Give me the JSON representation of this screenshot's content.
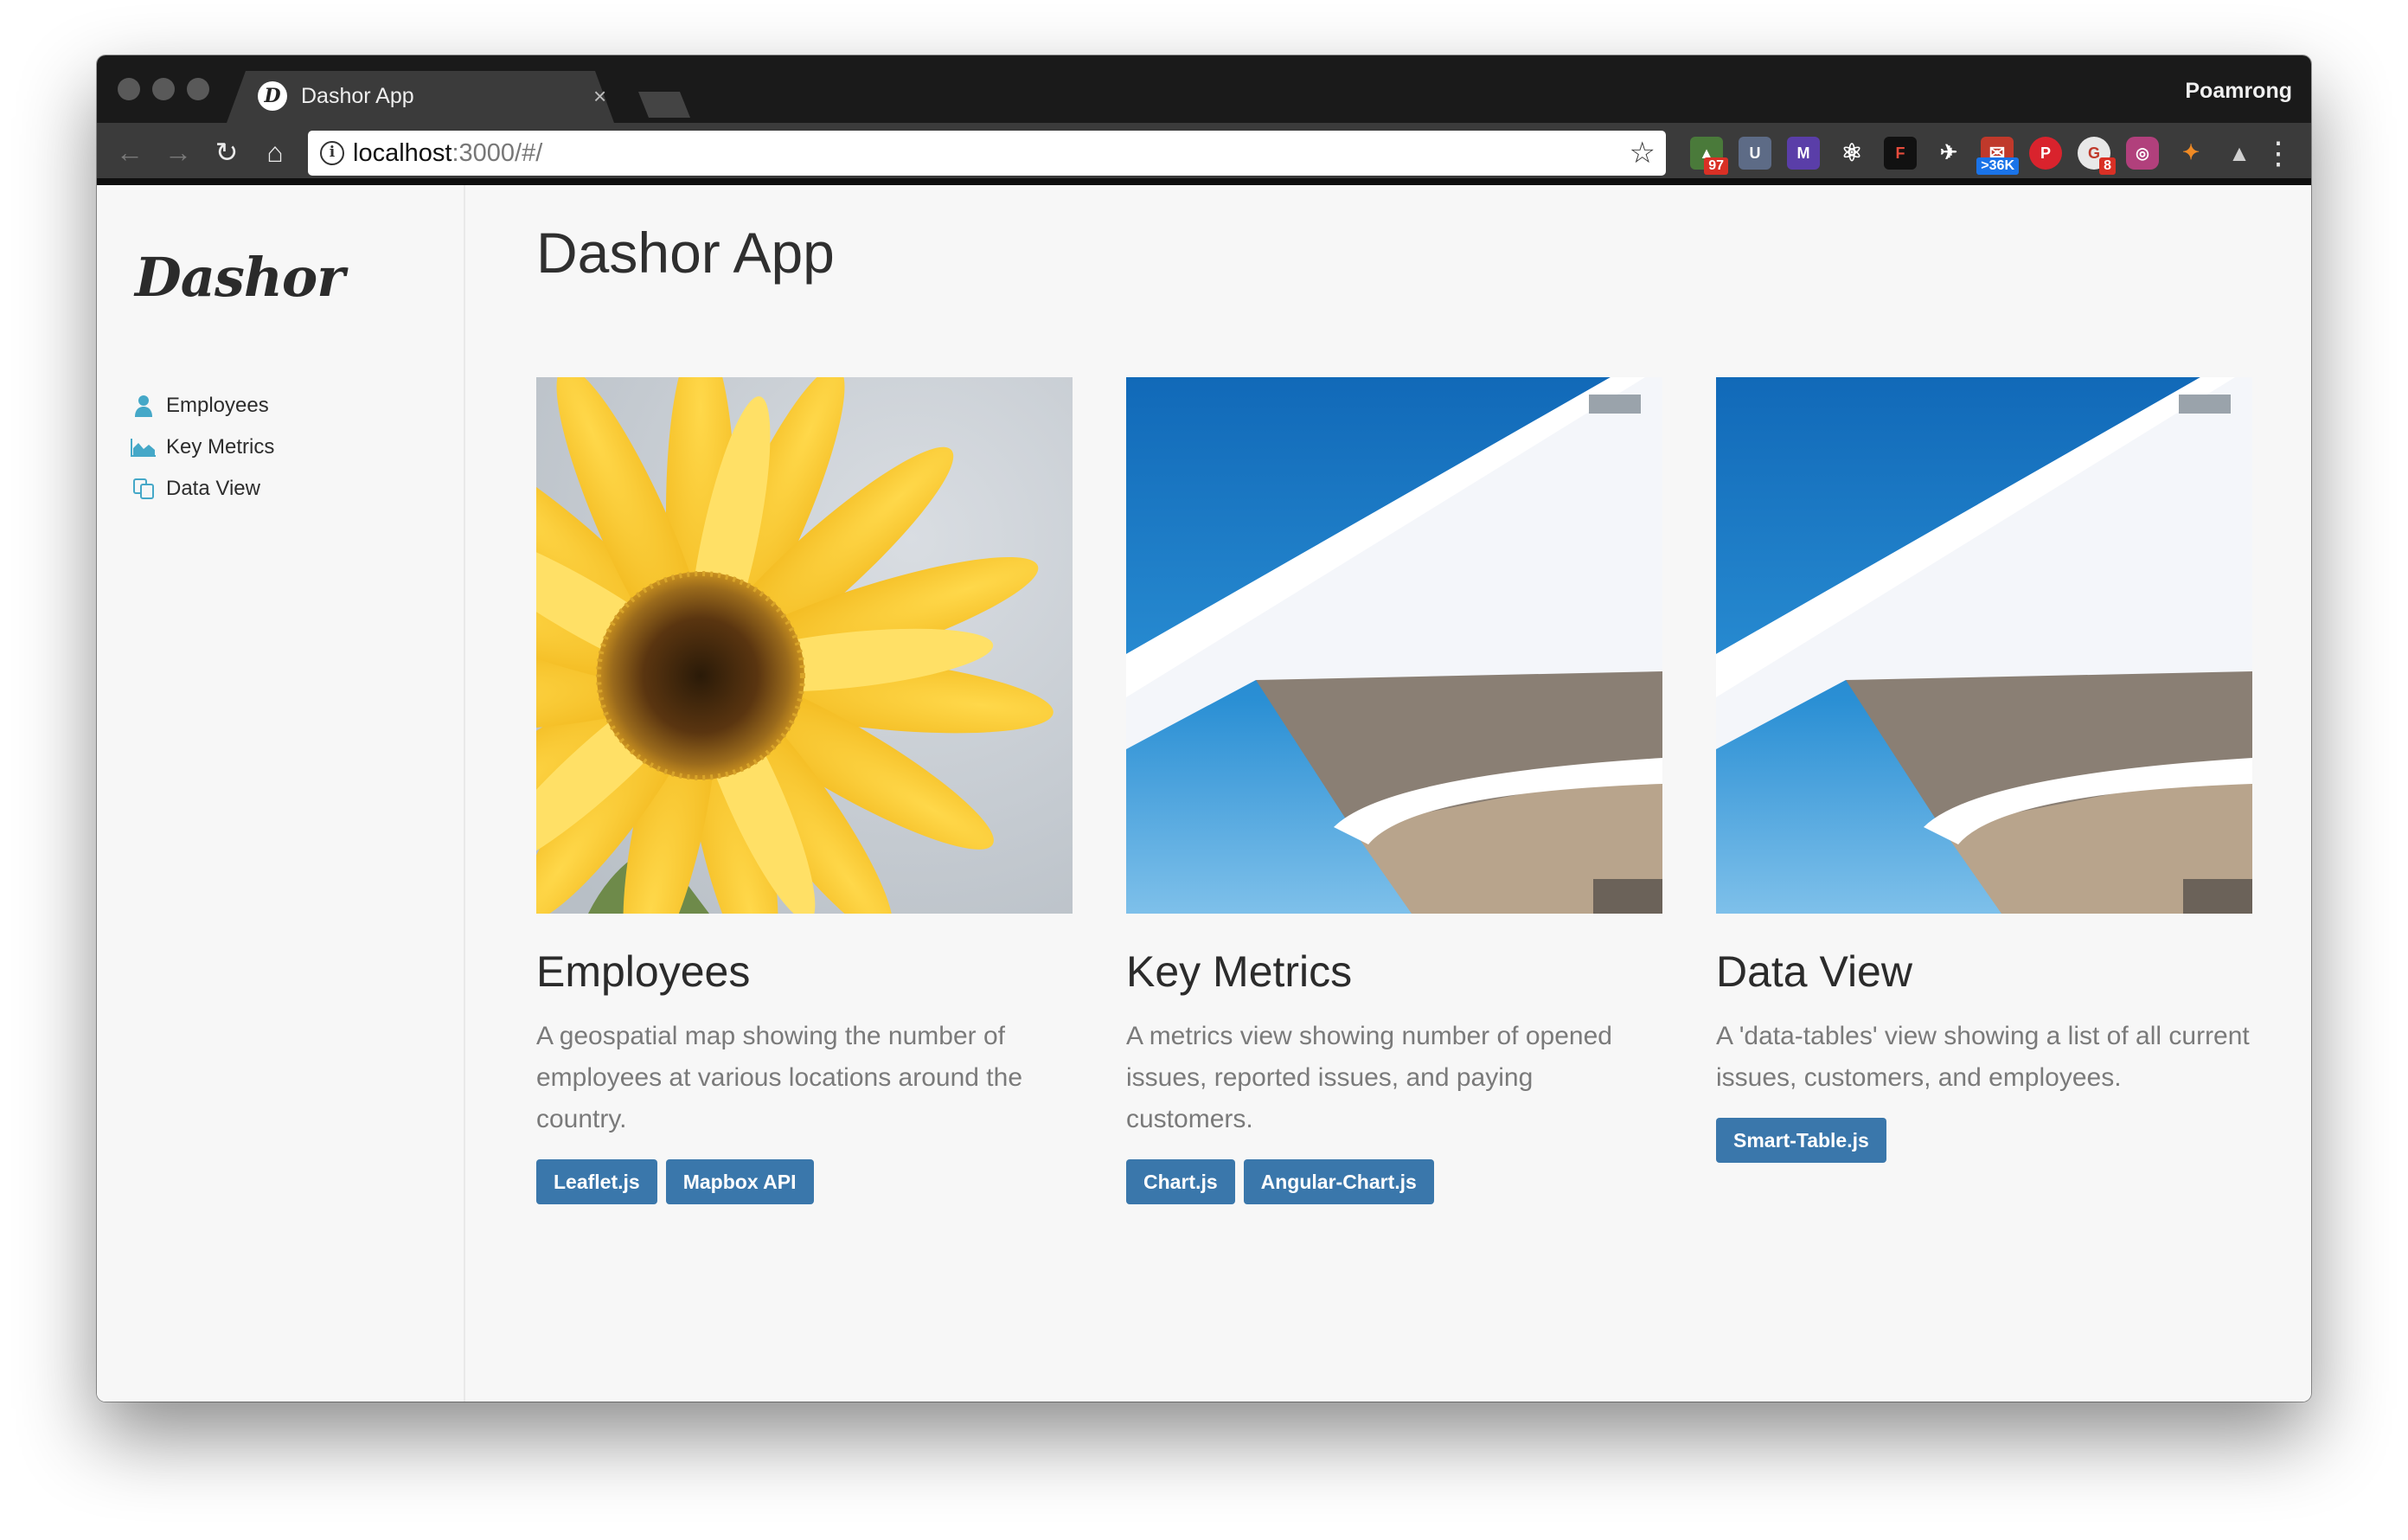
{
  "browser": {
    "tab_title": "Dashor App",
    "tab_favicon_letter": "D",
    "close_glyph": "×",
    "profile_name": "Poamrong",
    "url_host": "localhost",
    "url_rest": ":3000/#/",
    "back_glyph": "←",
    "forward_glyph": "→",
    "reload_glyph": "↻",
    "home_glyph": "⌂",
    "info_glyph": "i",
    "star_glyph": "☆",
    "menu_glyph": "⋮",
    "extensions": [
      {
        "name": "ext-android-icon",
        "glyph": "▲",
        "badge": "97"
      },
      {
        "name": "ext-u-icon",
        "glyph": "U",
        "badge": ""
      },
      {
        "name": "ext-m-icon",
        "glyph": "M",
        "badge": ""
      },
      {
        "name": "ext-react-icon",
        "glyph": "⚛",
        "badge": ""
      },
      {
        "name": "ext-f-icon",
        "glyph": "F",
        "badge": ""
      },
      {
        "name": "ext-pin-icon",
        "glyph": "✈",
        "badge": ""
      },
      {
        "name": "ext-mail-icon",
        "glyph": "✉",
        "badge": ">36K"
      },
      {
        "name": "ext-pinterest-icon",
        "glyph": "P",
        "badge": ""
      },
      {
        "name": "ext-g-icon",
        "glyph": "G",
        "badge": "8"
      },
      {
        "name": "ext-instagram-icon",
        "glyph": "◎",
        "badge": ""
      },
      {
        "name": "ext-metamask-icon",
        "glyph": "✦",
        "badge": ""
      },
      {
        "name": "ext-drive-icon",
        "glyph": "▲",
        "badge": ""
      }
    ]
  },
  "sidebar": {
    "brand": "Dashor",
    "items": [
      {
        "label": "Employees",
        "icon": "user-icon"
      },
      {
        "label": "Key Metrics",
        "icon": "area-chart-icon"
      },
      {
        "label": "Data View",
        "icon": "copy-icon"
      }
    ]
  },
  "main": {
    "title": "Dashor App",
    "cards": [
      {
        "title": "Employees",
        "description": "A geospatial map showing the number of employees at various locations around the country.",
        "image": "sunflower-image",
        "tags": [
          "Leaflet.js",
          "Mapbox API"
        ]
      },
      {
        "title": "Key Metrics",
        "description": "A metrics view showing number of opened issues, reported issues, and paying customers.",
        "image": "architecture-image",
        "tags": [
          "Chart.js",
          "Angular-Chart.js"
        ]
      },
      {
        "title": "Data View",
        "description": "A 'data-tables' view showing a list of all current issues, customers, and employees.",
        "image": "architecture-image",
        "tags": [
          "Smart-Table.js"
        ]
      }
    ]
  },
  "colors": {
    "accent": "#3a77ab",
    "nav_icon": "#45a8c8",
    "page_bg": "#f7f7f7"
  }
}
